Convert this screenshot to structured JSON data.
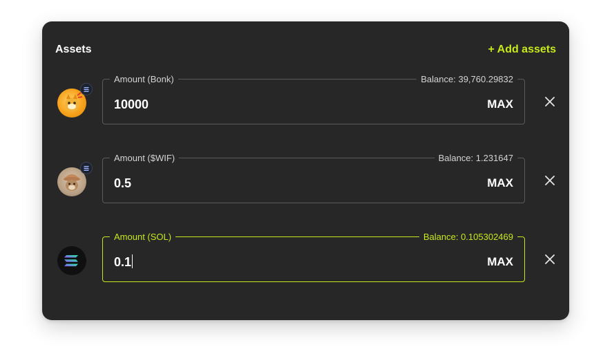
{
  "header": {
    "title": "Assets",
    "add_label": "+ Add assets"
  },
  "assets": [
    {
      "token_name": "Bonk",
      "legend": "Amount (Bonk)",
      "balance": "Balance: 39,760.29832",
      "amount": "10000",
      "max_label": "MAX",
      "icon": "bonk-token-icon",
      "chain_icon": "solana-chain-icon",
      "active": false
    },
    {
      "token_name": "$WIF",
      "legend": "Amount ($WIF)",
      "balance": "Balance: 1.231647",
      "amount": "0.5",
      "max_label": "MAX",
      "icon": "wif-token-icon",
      "chain_icon": "solana-chain-icon",
      "active": false
    },
    {
      "token_name": "SOL",
      "legend": "Amount (SOL)",
      "balance": "Balance: 0.105302469",
      "amount": "0.1",
      "max_label": "MAX",
      "icon": "sol-token-icon",
      "active": true
    }
  ],
  "colors": {
    "accent": "#c5e91d",
    "card_bg": "#272727",
    "border": "#5a5a5a"
  }
}
